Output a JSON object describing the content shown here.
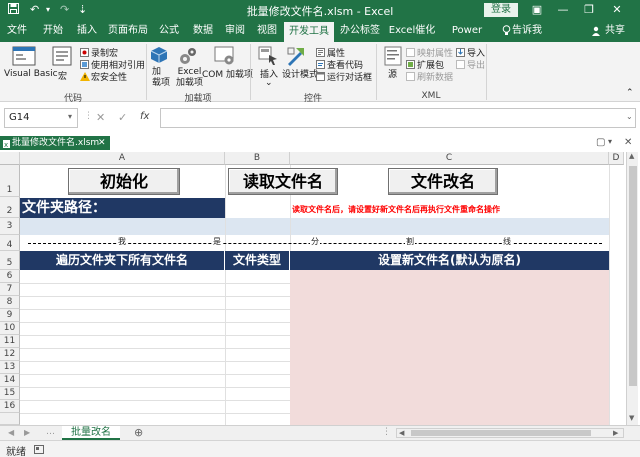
{
  "window": {
    "title": "批量修改文件名.xlsm  -  Excel",
    "login_label": "登录",
    "minimize": "—",
    "restore": "❐",
    "close": "✕"
  },
  "quick_access": [
    "save-icon",
    "undo-icon",
    "redo-icon",
    "customize-icon"
  ],
  "tabs": [
    {
      "label": "文件",
      "active": false
    },
    {
      "label": "开始",
      "active": false
    },
    {
      "label": "插入",
      "active": false
    },
    {
      "label": "页面布局",
      "active": false
    },
    {
      "label": "公式",
      "active": false
    },
    {
      "label": "数据",
      "active": false
    },
    {
      "label": "审阅",
      "active": false
    },
    {
      "label": "视图",
      "active": false
    },
    {
      "label": "开发工具",
      "active": true
    },
    {
      "label": "办公标签",
      "active": false
    },
    {
      "label": "Excel催化剂",
      "active": false
    },
    {
      "label": "Power Pivot",
      "active": false
    },
    {
      "label": "告诉我",
      "active": false
    },
    {
      "label": "共享",
      "active": false
    }
  ],
  "ribbon": {
    "code": {
      "visual_basic": "Visual Basic",
      "macros": "宏",
      "record_macro": "录制宏",
      "relative_refs": "使用相对引用",
      "macro_security": "宏安全性",
      "group": "代码"
    },
    "addins": {
      "addins": "加\n载项",
      "excel_addins": "Excel\n加载项",
      "com_addins": "COM 加载项",
      "group": "加载项"
    },
    "controls": {
      "insert": "插入",
      "design_mode": "设计模式",
      "properties": "属性",
      "view_code": "查看代码",
      "run_dialog": "运行对话框",
      "group": "控件"
    },
    "xml": {
      "source": "源",
      "map_properties": "映射属性",
      "expansion_packs": "扩展包",
      "refresh_data": "刷新数据",
      "import": "导入",
      "export": "导出",
      "group": "XML"
    }
  },
  "formula_bar": {
    "name_box": "G14",
    "cancel": "✕",
    "enter": "✓",
    "fx": "fx",
    "value": ""
  },
  "workbook_tab": "批量修改文件名.xlsm",
  "columns": [
    "A",
    "B",
    "C",
    "D"
  ],
  "rows": [
    "1",
    "2",
    "3",
    "4",
    "5",
    "6",
    "7",
    "8",
    "9",
    "10",
    "11",
    "12",
    "13",
    "14",
    "15",
    "16"
  ],
  "sheet": {
    "btn_init": "初始化",
    "btn_read": "读取文件名",
    "btn_rename": "文件改名",
    "folder_label": "文件夹路径：",
    "note": "读取文件名后，请设置好新文件名后再执行文件重命名操作",
    "divider_chars": [
      "我",
      "是",
      "分",
      "割",
      "线"
    ],
    "header_a": "遍历文件夹下所有文件名",
    "header_b": "文件类型",
    "header_c": "设置新文件名(默认为原名)"
  },
  "sheet_tabs": [
    {
      "label": "批量改名",
      "active": true
    }
  ],
  "status": {
    "ready": "就绪"
  },
  "colors": {
    "excel_green": "#217346",
    "header_blue": "#203864",
    "light_blue": "#dce6f1",
    "pink": "#f2dcdb",
    "note_red": "#ff0000"
  }
}
